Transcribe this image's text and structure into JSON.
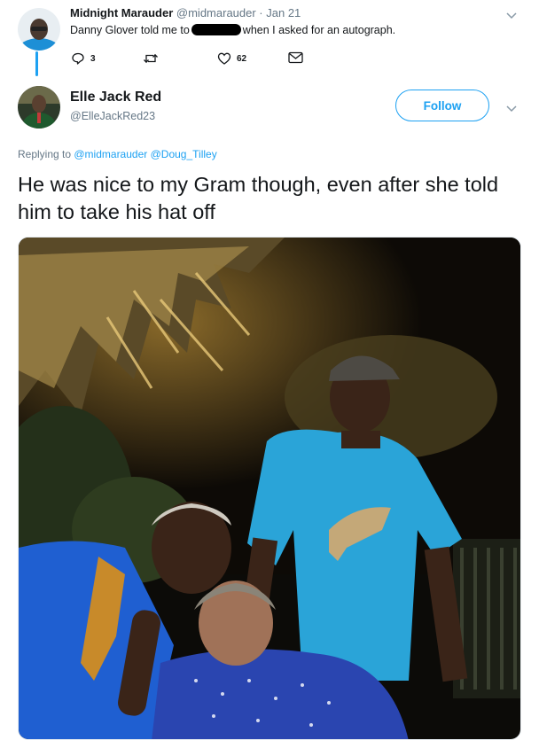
{
  "parent_tweet": {
    "author_name": "Midnight Marauder",
    "author_handle": "@midmarauder",
    "separator": " · ",
    "date": "Jan 21",
    "text_before": "Danny Glover told me to",
    "text_after": "when I asked for an autograph.",
    "reply_count": "3",
    "retweet_count": "",
    "like_count": "62"
  },
  "reply_tweet": {
    "author_name": "Elle Jack Red",
    "author_handle": "@ElleJackRed23",
    "follow_label": "Follow",
    "replying_prefix": "Replying to ",
    "replying_to_1": "@midmarauder",
    "replying_to_2": "@Doug_Tilley",
    "text": "He was nice to my Gram though, even after she told him to take his hat off"
  },
  "colors": {
    "accent": "#1da1f2",
    "secondary_text": "#657786",
    "primary_text": "#14171a"
  },
  "icons": [
    "reply-icon",
    "retweet-icon",
    "like-icon",
    "dm-icon",
    "chevron-down-icon"
  ]
}
